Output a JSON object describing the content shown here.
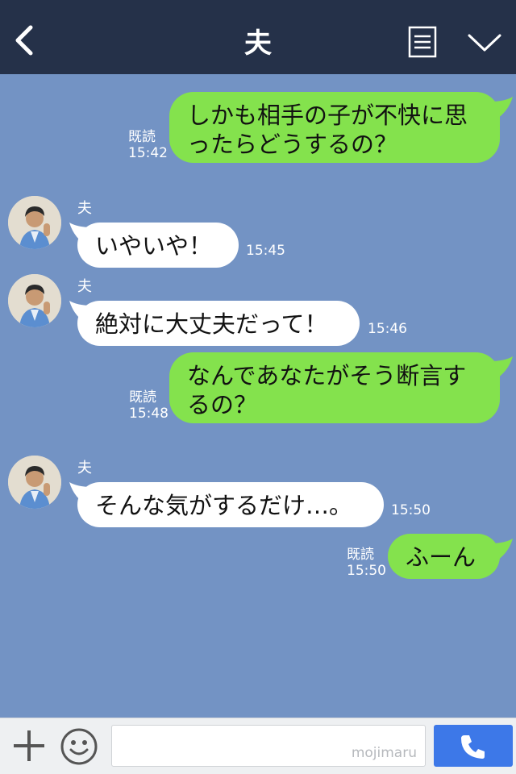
{
  "header": {
    "title": "夫"
  },
  "messages": [
    {
      "from": "me",
      "lines": [
        "しかも相手の子が不快に思",
        "ったらどうするの？"
      ],
      "read": "既読",
      "time": "15:42"
    },
    {
      "from": "them",
      "sender": "夫",
      "lines": [
        "いやいや！"
      ],
      "time": "15:45"
    },
    {
      "from": "them",
      "sender": "夫",
      "lines": [
        "絶対に大丈夫だって！"
      ],
      "time": "15:46"
    },
    {
      "from": "me",
      "lines": [
        "なんであなたがそう断言す",
        "るの？"
      ],
      "read": "既読",
      "time": "15:48"
    },
    {
      "from": "them",
      "sender": "夫",
      "lines": [
        "そんな気がするだけ…。"
      ],
      "time": "15:50"
    },
    {
      "from": "me",
      "lines": [
        "ふーん"
      ],
      "read": "既読",
      "time": "15:50"
    }
  ],
  "footer": {
    "input_value": "",
    "watermark": "mojimaru"
  },
  "colors": {
    "header_bg": "#253149",
    "chat_bg": "#7393c4",
    "outgoing_bubble": "#84e24d",
    "incoming_bubble": "#ffffff",
    "call_button": "#3d78e8"
  },
  "icons": [
    "back-chevron-icon",
    "menu-icon",
    "chevron-down-icon",
    "plus-icon",
    "emoji-icon",
    "phone-icon"
  ]
}
